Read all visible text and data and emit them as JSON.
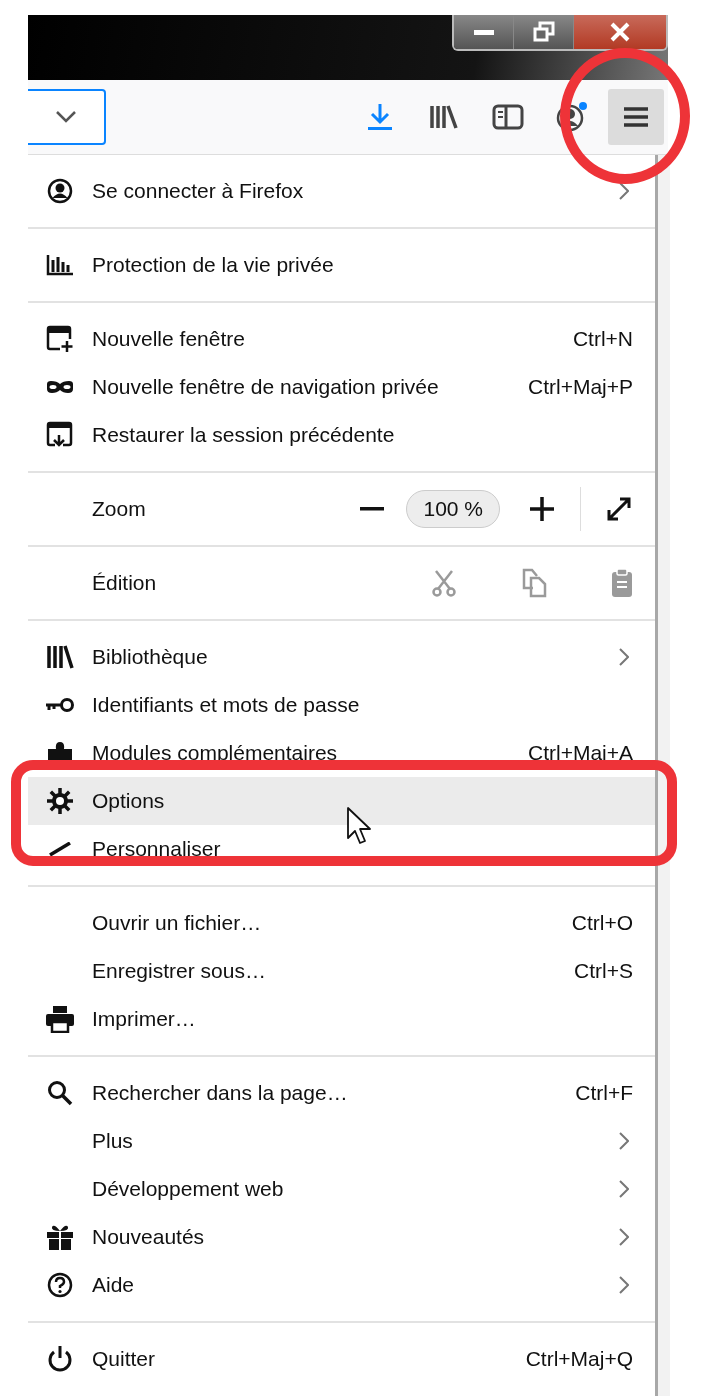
{
  "window": {
    "controls": [
      {
        "kind": "minimize"
      },
      {
        "kind": "restore"
      },
      {
        "kind": "close"
      }
    ]
  },
  "toolbar": {
    "buttons": [
      {
        "kind": "downloads",
        "selected": false
      },
      {
        "kind": "library",
        "selected": false
      },
      {
        "kind": "sidebar",
        "selected": false
      },
      {
        "kind": "account",
        "selected": false
      },
      {
        "kind": "menu",
        "selected": true
      }
    ]
  },
  "menu": {
    "sections": [
      {
        "items": [
          {
            "kind": "item",
            "label": "Se connecter à Firefox",
            "submenu": true,
            "hovered": false
          }
        ]
      },
      {
        "items": [
          {
            "kind": "item",
            "label": "Protection de la vie privée",
            "submenu": false,
            "hovered": false
          }
        ]
      },
      {
        "items": [
          {
            "kind": "item",
            "label": "Nouvelle fenêtre",
            "shortcut": "Ctrl+N",
            "submenu": false,
            "hovered": false
          },
          {
            "kind": "item",
            "label": "Nouvelle fenêtre de navigation privée",
            "shortcut": "Ctrl+Maj+P",
            "submenu": false,
            "hovered": false
          },
          {
            "kind": "item",
            "label": "Restaurer la session précédente",
            "submenu": false,
            "hovered": false
          }
        ]
      },
      {
        "items": [
          {
            "kind": "zoom",
            "label": "Zoom",
            "value": "100 %"
          }
        ]
      },
      {
        "items": [
          {
            "kind": "edit",
            "label": "Édition",
            "disabled": true
          }
        ]
      },
      {
        "items": [
          {
            "kind": "item",
            "label": "Bibliothèque",
            "submenu": true,
            "hovered": false
          },
          {
            "kind": "item",
            "label": "Identifiants et mots de passe",
            "submenu": false,
            "hovered": false
          },
          {
            "kind": "item",
            "label": "Modules complémentaires",
            "shortcut": "Ctrl+Maj+A",
            "submenu": false,
            "hovered": false
          },
          {
            "kind": "item",
            "label": "Options",
            "submenu": false,
            "hovered": true
          },
          {
            "kind": "item",
            "label": "Personnaliser",
            "submenu": false,
            "hovered": false
          }
        ]
      },
      {
        "items": [
          {
            "kind": "item",
            "label": "Ouvrir un fichier…",
            "shortcut": "Ctrl+O",
            "submenu": false,
            "hovered": false
          },
          {
            "kind": "item",
            "label": "Enregistrer sous…",
            "shortcut": "Ctrl+S",
            "submenu": false,
            "hovered": false
          },
          {
            "kind": "item",
            "label": "Imprimer…",
            "submenu": false,
            "hovered": false
          }
        ]
      },
      {
        "items": [
          {
            "kind": "item",
            "label": "Rechercher dans la page…",
            "shortcut": "Ctrl+F",
            "submenu": false,
            "hovered": false
          },
          {
            "kind": "item",
            "label": "Plus",
            "submenu": true,
            "hovered": false
          },
          {
            "kind": "item",
            "label": "Développement web",
            "submenu": true,
            "hovered": false
          },
          {
            "kind": "item",
            "label": "Nouveautés",
            "submenu": true,
            "hovered": false
          },
          {
            "kind": "item",
            "label": "Aide",
            "submenu": true,
            "hovered": false
          }
        ]
      },
      {
        "items": [
          {
            "kind": "item",
            "label": "Quitter",
            "shortcut": "Ctrl+Maj+Q",
            "submenu": false,
            "hovered": false
          }
        ]
      }
    ]
  },
  "annotations": [
    {
      "kind": "circle"
    },
    {
      "kind": "frame"
    }
  ]
}
